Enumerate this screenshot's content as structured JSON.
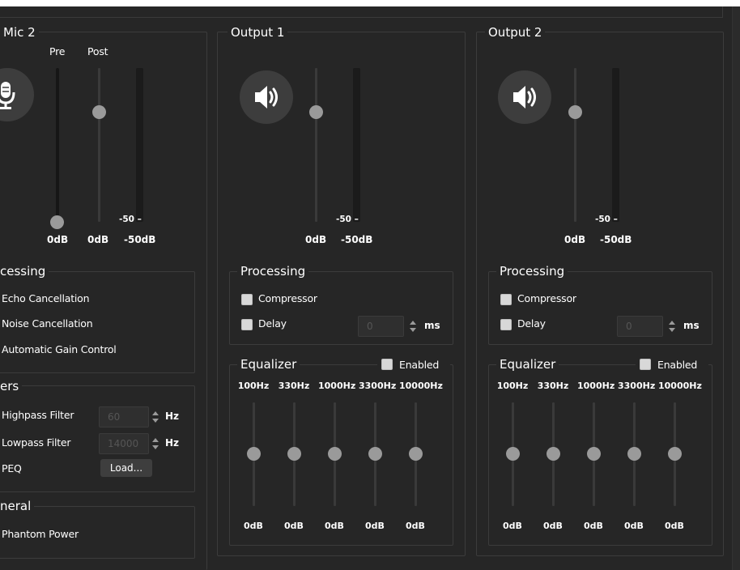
{
  "mic2": {
    "title": "Mic 2",
    "pre_label": "Pre",
    "post_label": "Post",
    "meter_mark": "-50 –",
    "pre_value": "0dB",
    "post_value": "0dB",
    "meter_value": "-50dB",
    "processing": {
      "title": "cessing",
      "items": [
        "Echo Cancellation",
        "Noise Cancellation",
        "Automatic Gain Control"
      ]
    },
    "filters": {
      "title": "ers",
      "highpass_label": "Highpass Filter",
      "highpass_value": "60",
      "lowpass_label": "Lowpass Filter",
      "lowpass_value": "14000",
      "hz": "Hz",
      "peq_label": "PEQ",
      "load_button": "Load..."
    },
    "general": {
      "title": "neral",
      "phantom_label": "Phantom Power"
    }
  },
  "output1": {
    "title": "Output 1",
    "meter_mark": "-50 –",
    "fader_value": "0dB",
    "meter_value": "-50dB",
    "processing_title": "Processing",
    "compressor_label": "Compressor",
    "delay_label": "Delay",
    "delay_value": "0",
    "delay_unit": "ms",
    "equalizer_title": "Equalizer",
    "enabled_label": "Enabled",
    "bands": [
      "100Hz",
      "330Hz",
      "1000Hz",
      "3300Hz",
      "10000Hz"
    ],
    "band_values": [
      "0dB",
      "0dB",
      "0dB",
      "0dB",
      "0dB"
    ]
  },
  "output2": {
    "title": "Output 2",
    "meter_mark": "-50 –",
    "fader_value": "0dB",
    "meter_value": "-50dB",
    "processing_title": "Processing",
    "compressor_label": "Compressor",
    "delay_label": "Delay",
    "delay_value": "0",
    "delay_unit": "ms",
    "equalizer_title": "Equalizer",
    "enabled_label": "Enabled",
    "bands": [
      "100Hz",
      "330Hz",
      "1000Hz",
      "3300Hz",
      "10000Hz"
    ],
    "band_values": [
      "0dB",
      "0dB",
      "0dB",
      "0dB",
      "0dB"
    ]
  },
  "icons": {
    "mic": "microphone-icon",
    "speaker": "speaker-icon"
  },
  "colors": {
    "background": "#262626",
    "panel_border": "#3c3c3c",
    "knob": "#9a9a9a",
    "checkbox": "#d8d8d8"
  }
}
